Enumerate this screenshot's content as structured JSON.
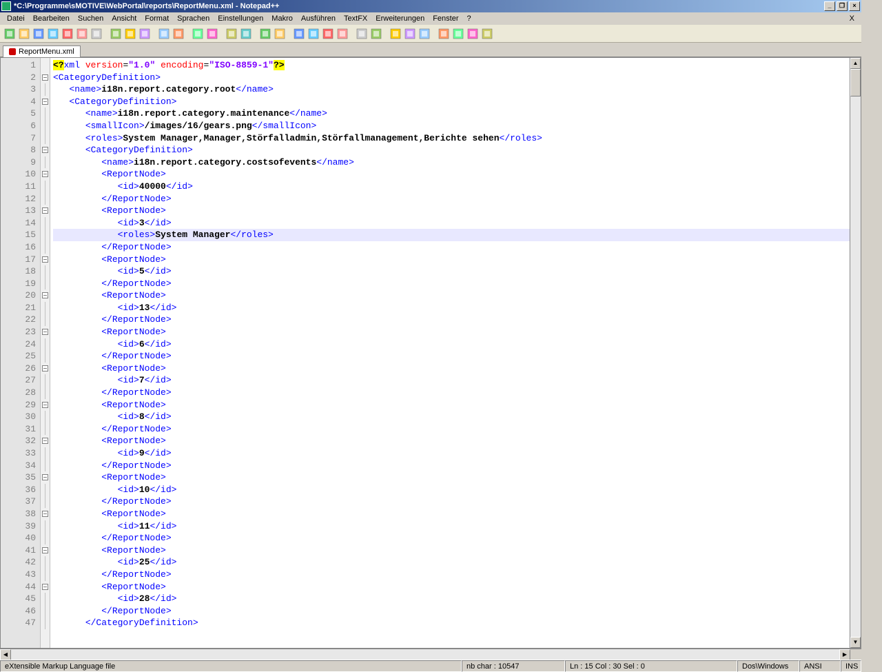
{
  "window": {
    "title": "*C:\\Programme\\sMOTIVE\\WebPortal\\reports\\ReportMenu.xml - Notepad++"
  },
  "menu": [
    "Datei",
    "Bearbeiten",
    "Suchen",
    "Ansicht",
    "Format",
    "Sprachen",
    "Einstellungen",
    "Makro",
    "Ausführen",
    "TextFX",
    "Erweiterungen",
    "Fenster",
    "?"
  ],
  "tab": {
    "label": "ReportMenu.xml"
  },
  "status": {
    "filetype": "eXtensible Markup Language file",
    "chars": "nb char : 10547",
    "pos": "Ln : 15    Col : 30    Sel : 0",
    "eol": "Dos\\Windows",
    "enc": "ANSI",
    "mode": "INS"
  },
  "code": {
    "cursor_line": 15,
    "lines": [
      {
        "n": 1,
        "fold": "",
        "html": "<span class='pi'>&lt;?</span><span class='pikw'>xml</span> <span class='attr'>version</span>=<span class='str'>\"1.0\"</span> <span class='attr'>encoding</span>=<span class='str'>\"ISO-8859-1\"</span><span class='pi'>?&gt;</span>"
      },
      {
        "n": 2,
        "fold": "box",
        "html": "<span class='tag'>&lt;CategoryDefinition&gt;</span>"
      },
      {
        "n": 3,
        "fold": "line",
        "html": "   <span class='tag'>&lt;name&gt;</span><span class='txt'>i18n.report.category.root</span><span class='tag'>&lt;/name&gt;</span>"
      },
      {
        "n": 4,
        "fold": "box",
        "html": "   <span class='tag'>&lt;CategoryDefinition&gt;</span>"
      },
      {
        "n": 5,
        "fold": "line",
        "html": "      <span class='tag'>&lt;name&gt;</span><span class='txt'>i18n.report.category.maintenance</span><span class='tag'>&lt;/name&gt;</span>"
      },
      {
        "n": 6,
        "fold": "line",
        "html": "      <span class='tag'>&lt;smallIcon&gt;</span><span class='txt'>/images/16/gears.png</span><span class='tag'>&lt;/smallIcon&gt;</span>"
      },
      {
        "n": 7,
        "fold": "line",
        "html": "      <span class='tag'>&lt;roles&gt;</span><span class='txt'>System Manager,Manager,Störfalladmin,Störfallmanagement,Berichte sehen</span><span class='tag'>&lt;/roles&gt;</span>"
      },
      {
        "n": 8,
        "fold": "box",
        "html": "      <span class='tag'>&lt;CategoryDefinition&gt;</span>"
      },
      {
        "n": 9,
        "fold": "line",
        "html": "         <span class='tag'>&lt;name&gt;</span><span class='txt'>i18n.report.category.costsofevents</span><span class='tag'>&lt;/name&gt;</span>"
      },
      {
        "n": 10,
        "fold": "box",
        "html": "         <span class='tag'>&lt;ReportNode&gt;</span>"
      },
      {
        "n": 11,
        "fold": "line",
        "html": "            <span class='tag'>&lt;id&gt;</span><span class='txt'>40000</span><span class='tag'>&lt;/id&gt;</span>"
      },
      {
        "n": 12,
        "fold": "line",
        "html": "         <span class='tag'>&lt;/ReportNode&gt;</span>"
      },
      {
        "n": 13,
        "fold": "box",
        "html": "         <span class='tag'>&lt;ReportNode&gt;</span>"
      },
      {
        "n": 14,
        "fold": "line",
        "html": "            <span class='tag'>&lt;id&gt;</span><span class='txt'>3</span><span class='tag'>&lt;/id&gt;</span>"
      },
      {
        "n": 15,
        "fold": "line",
        "html": "            <span class='tag'>&lt;roles&gt;</span><span class='txt'>System Manager</span><span class='tag'>&lt;/roles&gt;</span>"
      },
      {
        "n": 16,
        "fold": "line",
        "html": "         <span class='tag'>&lt;/ReportNode&gt;</span>"
      },
      {
        "n": 17,
        "fold": "box",
        "html": "         <span class='tag'>&lt;ReportNode&gt;</span>"
      },
      {
        "n": 18,
        "fold": "line",
        "html": "            <span class='tag'>&lt;id&gt;</span><span class='txt'>5</span><span class='tag'>&lt;/id&gt;</span>"
      },
      {
        "n": 19,
        "fold": "line",
        "html": "         <span class='tag'>&lt;/ReportNode&gt;</span>"
      },
      {
        "n": 20,
        "fold": "box",
        "html": "         <span class='tag'>&lt;ReportNode&gt;</span>"
      },
      {
        "n": 21,
        "fold": "line",
        "html": "            <span class='tag'>&lt;id&gt;</span><span class='txt'>13</span><span class='tag'>&lt;/id&gt;</span>"
      },
      {
        "n": 22,
        "fold": "line",
        "html": "         <span class='tag'>&lt;/ReportNode&gt;</span>"
      },
      {
        "n": 23,
        "fold": "box",
        "html": "         <span class='tag'>&lt;ReportNode&gt;</span>"
      },
      {
        "n": 24,
        "fold": "line",
        "html": "            <span class='tag'>&lt;id&gt;</span><span class='txt'>6</span><span class='tag'>&lt;/id&gt;</span>"
      },
      {
        "n": 25,
        "fold": "line",
        "html": "         <span class='tag'>&lt;/ReportNode&gt;</span>"
      },
      {
        "n": 26,
        "fold": "box",
        "html": "         <span class='tag'>&lt;ReportNode&gt;</span>"
      },
      {
        "n": 27,
        "fold": "line",
        "html": "            <span class='tag'>&lt;id&gt;</span><span class='txt'>7</span><span class='tag'>&lt;/id&gt;</span>"
      },
      {
        "n": 28,
        "fold": "line",
        "html": "         <span class='tag'>&lt;/ReportNode&gt;</span>"
      },
      {
        "n": 29,
        "fold": "box",
        "html": "         <span class='tag'>&lt;ReportNode&gt;</span>"
      },
      {
        "n": 30,
        "fold": "line",
        "html": "            <span class='tag'>&lt;id&gt;</span><span class='txt'>8</span><span class='tag'>&lt;/id&gt;</span>"
      },
      {
        "n": 31,
        "fold": "line",
        "html": "         <span class='tag'>&lt;/ReportNode&gt;</span>"
      },
      {
        "n": 32,
        "fold": "box",
        "html": "         <span class='tag'>&lt;ReportNode&gt;</span>"
      },
      {
        "n": 33,
        "fold": "line",
        "html": "            <span class='tag'>&lt;id&gt;</span><span class='txt'>9</span><span class='tag'>&lt;/id&gt;</span>"
      },
      {
        "n": 34,
        "fold": "line",
        "html": "         <span class='tag'>&lt;/ReportNode&gt;</span>"
      },
      {
        "n": 35,
        "fold": "box",
        "html": "         <span class='tag'>&lt;ReportNode&gt;</span>"
      },
      {
        "n": 36,
        "fold": "line",
        "html": "            <span class='tag'>&lt;id&gt;</span><span class='txt'>10</span><span class='tag'>&lt;/id&gt;</span>"
      },
      {
        "n": 37,
        "fold": "line",
        "html": "         <span class='tag'>&lt;/ReportNode&gt;</span>"
      },
      {
        "n": 38,
        "fold": "box",
        "html": "         <span class='tag'>&lt;ReportNode&gt;</span>"
      },
      {
        "n": 39,
        "fold": "line",
        "html": "            <span class='tag'>&lt;id&gt;</span><span class='txt'>11</span><span class='tag'>&lt;/id&gt;</span>"
      },
      {
        "n": 40,
        "fold": "line",
        "html": "         <span class='tag'>&lt;/ReportNode&gt;</span>"
      },
      {
        "n": 41,
        "fold": "box",
        "html": "         <span class='tag'>&lt;ReportNode&gt;</span>"
      },
      {
        "n": 42,
        "fold": "line",
        "html": "            <span class='tag'>&lt;id&gt;</span><span class='txt'>25</span><span class='tag'>&lt;/id&gt;</span>"
      },
      {
        "n": 43,
        "fold": "line",
        "html": "         <span class='tag'>&lt;/ReportNode&gt;</span>"
      },
      {
        "n": 44,
        "fold": "box",
        "html": "         <span class='tag'>&lt;ReportNode&gt;</span>"
      },
      {
        "n": 45,
        "fold": "line",
        "html": "            <span class='tag'>&lt;id&gt;</span><span class='txt'>28</span><span class='tag'>&lt;/id&gt;</span>"
      },
      {
        "n": 46,
        "fold": "line",
        "html": "         <span class='tag'>&lt;/ReportNode&gt;</span>"
      },
      {
        "n": 47,
        "fold": "line",
        "html": "      <span class='tag'>&lt;/CategoryDefinition&gt;</span>"
      }
    ]
  },
  "toolbar_icons": [
    "new",
    "open",
    "save",
    "save-all",
    "close",
    "close-all",
    "print",
    "sep",
    "cut",
    "copy",
    "paste",
    "sep",
    "undo",
    "redo",
    "sep",
    "find",
    "replace",
    "sep",
    "zoom-in",
    "zoom-out",
    "sep",
    "sync-v",
    "sync-h",
    "sep",
    "wrap",
    "show-all",
    "indent",
    "guide",
    "sep",
    "record",
    "play",
    "sep",
    "macro1",
    "macro2",
    "macro3",
    "sep",
    "plug1",
    "plug2",
    "plug3",
    "spell"
  ]
}
